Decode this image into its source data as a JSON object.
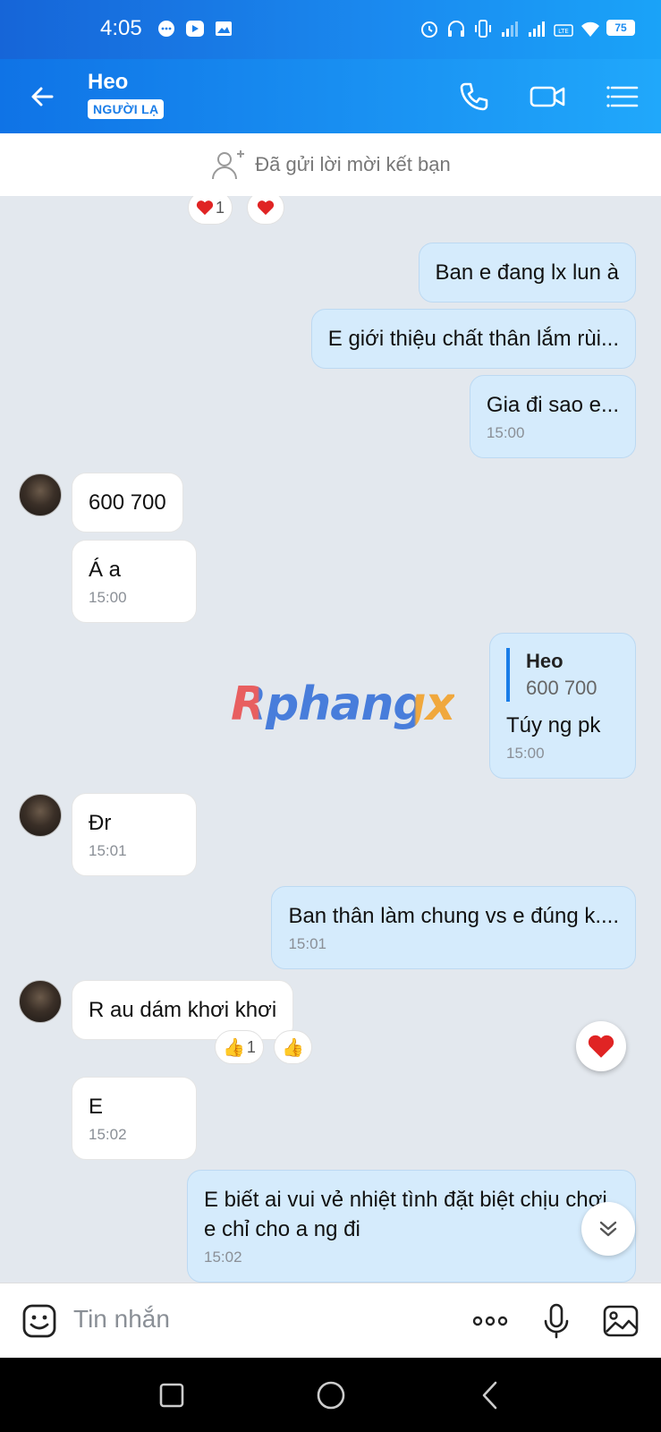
{
  "status_bar": {
    "time": "4:05",
    "battery": "75"
  },
  "header": {
    "name": "Heo",
    "badge": "NGƯỜI LẠ"
  },
  "friend_request": {
    "text": "Đã gửi lời mời kết bạn"
  },
  "top_reactions": {
    "heart_count": "1"
  },
  "messages": [
    {
      "dir": "out",
      "text": "Ban e đang lx lun à",
      "time": ""
    },
    {
      "dir": "out",
      "text": "E giới thiệu chất thân lắm rùi...",
      "time": ""
    },
    {
      "dir": "out",
      "text": "Gia đi sao e...",
      "time": "15:00"
    },
    {
      "dir": "in",
      "text": "600  700",
      "time": ""
    },
    {
      "dir": "in",
      "text": "Á a",
      "time": "15:00"
    },
    {
      "dir": "out",
      "quote_name": "Heo",
      "quote_text": "600  700",
      "text": "Túy ng pk",
      "time": "15:00"
    },
    {
      "dir": "in",
      "text": "Đr",
      "time": "15:01"
    },
    {
      "dir": "out",
      "text": "Ban thân làm chung vs e đúng k....",
      "time": "15:01"
    },
    {
      "dir": "in",
      "text": "R au dám khơi khơi",
      "time": "",
      "reaction_count": "1"
    },
    {
      "dir": "in",
      "text": "E",
      "time": "15:02"
    },
    {
      "dir": "out",
      "text": "E biết ai vui vẻ nhiệt tình đặt biệt chịu chơi e chỉ cho a ng đi",
      "time": "15:02"
    }
  ],
  "watermark": "Rphangx",
  "input": {
    "placeholder": "Tin nhắn"
  },
  "colors": {
    "header": "#1a8bf0",
    "outgoing_bubble": "#d5ebfc",
    "incoming_bubble": "#ffffff",
    "accent": "#1a7de8"
  }
}
